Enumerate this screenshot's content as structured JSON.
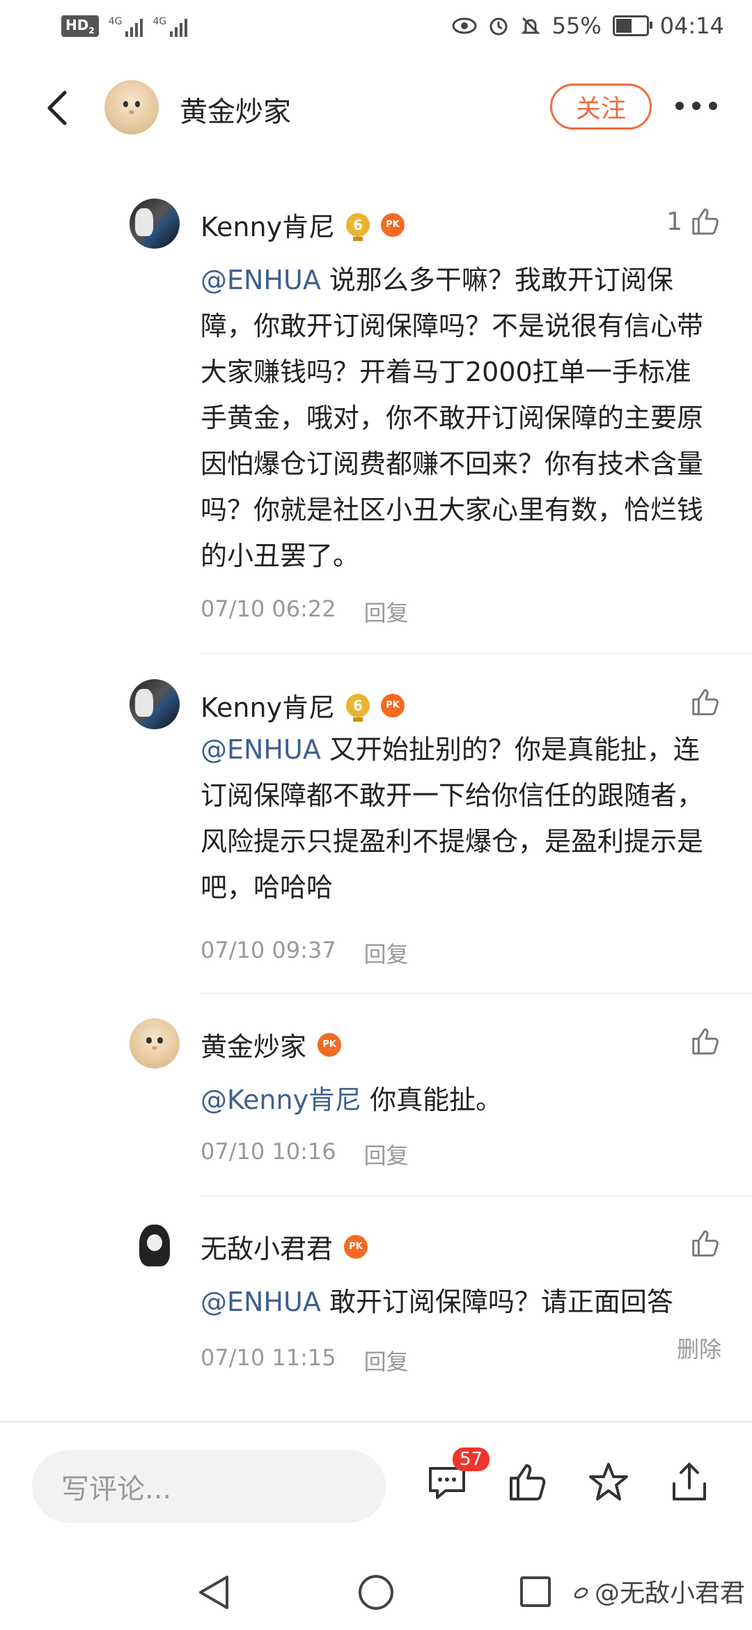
{
  "status_bar": {
    "hd": "HD",
    "hd_sub": "2",
    "net1": "4G",
    "net2": "4G",
    "battery": "55%",
    "battery_level": 0.55,
    "time": "04:14"
  },
  "header": {
    "title": "黄金炒家",
    "follow_label": "关注"
  },
  "comments": [
    {
      "user": "Kenny肯尼",
      "level": "6",
      "pk": "PK",
      "likes": "1",
      "mention": "@ENHUA",
      "text": " 说那么多干嘛？我敢开订阅保障，你敢开订阅保障吗？不是说很有信心带大家赚钱吗？开着马丁2000扛单一手标准手黄金，哦对，你不敢开订阅保障的主要原因怕爆仓订阅费都赚不回来？你有技术含量吗？你就是社区小丑大家心里有数，恰烂钱的小丑罢了。",
      "time": "07/10 06:22",
      "reply": "回复"
    },
    {
      "user": "Kenny肯尼",
      "level": "6",
      "pk": "PK",
      "likes": "",
      "mention": "@ENHUA",
      "text": " 又开始扯别的？你是真能扯，连订阅保障都不敢开一下给你信任的跟随者，风险提示只提盈利不提爆仓，是盈利提示是吧，哈哈哈",
      "time": "07/10 09:37",
      "reply": "回复"
    },
    {
      "user": "黄金炒家",
      "pk": "PK",
      "likes": "",
      "mention": "@Kenny肯尼",
      "text": " 你真能扯。",
      "time": "07/10 10:16",
      "reply": "回复"
    },
    {
      "user": "无敌小君君",
      "pk": "PK",
      "likes": "",
      "mention": "@ENHUA",
      "text": " 敢开订阅保障吗？请正面回答",
      "time": "07/10 11:15",
      "reply": "回复",
      "delete": "删除"
    }
  ],
  "bottom_bar": {
    "input_placeholder": "写评论...",
    "comment_count": "57"
  },
  "watermark": "@无敌小君君",
  "colors": {
    "accent": "#f26b3a",
    "mention": "#3f5f8f",
    "badge_red": "#f0342c"
  }
}
